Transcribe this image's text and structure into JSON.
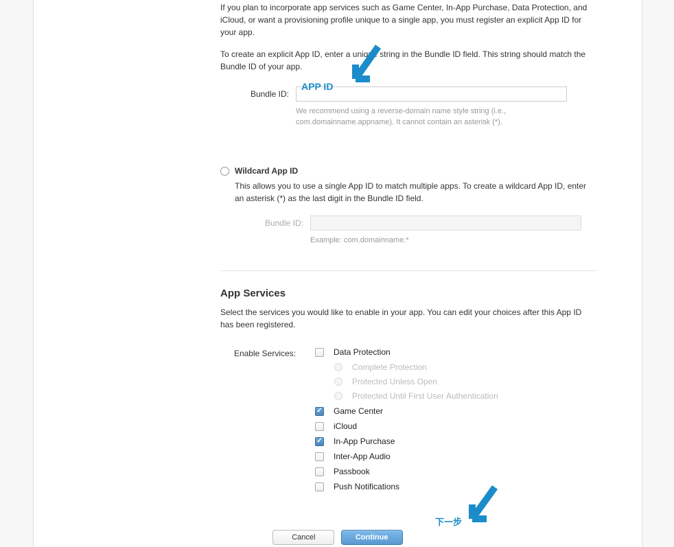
{
  "explicit": {
    "desc_p1": "If you plan to incorporate app services such as Game Center, In-App Purchase, Data Protection, and iCloud, or want a provisioning profile unique to a single app, you must register an explicit App ID for your app.",
    "desc_p2": "To create an explicit App ID, enter a unique string in the Bundle ID field. This string should match the Bundle ID of your app.",
    "bundle_label": "Bundle ID:",
    "bundle_value": "",
    "bundle_hint": "We recommend using a reverse-domain name style string (i.e., com.domainname.appname). It cannot contain an asterisk (*)."
  },
  "wildcard": {
    "title": "Wildcard App ID",
    "desc": "This allows you to use a single App ID to match multiple apps. To create a wildcard App ID, enter an asterisk (*) as the last digit in the Bundle ID field.",
    "bundle_label": "Bundle ID:",
    "bundle_value": "",
    "bundle_hint": "Example: com.domainname.*"
  },
  "services": {
    "title": "App Services",
    "desc": "Select the services you would like to enable in your app. You can edit your choices after this App ID has been registered.",
    "label": "Enable Services:",
    "items": [
      {
        "name": "Data Protection",
        "checked": false,
        "sub": [
          "Complete Protection",
          "Protected Unless Open",
          "Protected Until First User Authentication"
        ]
      },
      {
        "name": "Game Center",
        "checked": true
      },
      {
        "name": "iCloud",
        "checked": false
      },
      {
        "name": "In-App Purchase",
        "checked": true
      },
      {
        "name": "Inter-App Audio",
        "checked": false
      },
      {
        "name": "Passbook",
        "checked": false
      },
      {
        "name": "Push Notifications",
        "checked": false
      }
    ]
  },
  "buttons": {
    "cancel": "Cancel",
    "continue": "Continue"
  },
  "annotations": {
    "app_id_label": "APP ID",
    "next_step_label": "下一步"
  }
}
